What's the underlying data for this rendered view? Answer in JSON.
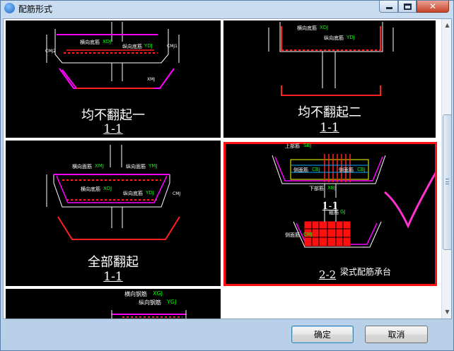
{
  "window": {
    "title": "配筋形式",
    "close_glyph": "✕"
  },
  "options": [
    {
      "caption": "均不翻起一",
      "section": "1-1",
      "labels": [
        "横向底筋",
        "XDJ",
        "纵向底筋",
        "YDJ",
        "CMJ1",
        "CMJ2",
        "XMJ"
      ]
    },
    {
      "caption": "均不翻起二",
      "section": "1-1",
      "labels": [
        "横向底筋",
        "XDJ",
        "纵向底筋",
        "YDJ"
      ]
    },
    {
      "caption": "全部翻起",
      "section": "1-1",
      "labels": [
        "横向面筋",
        "XMJ",
        "纵向面筋",
        "YMJ",
        "横向底筋",
        "XDJ",
        "纵向底筋",
        "YDJ",
        "CMJ"
      ]
    },
    {
      "caption": "梁式配筋承台",
      "section": "2-2",
      "labels": [
        "上部筋",
        "SBJ",
        "侧面筋",
        "CBJ",
        "侧面筋",
        "CBJ",
        "下部筋",
        "XBJ",
        "箍筋",
        "GJ",
        "侧面筋",
        "CMJ"
      ],
      "section_top": "1-1",
      "selected": true
    },
    {
      "caption": "",
      "section": "",
      "labels": [
        "横向钢筋",
        "XGJ",
        "纵向钢筋",
        "YGJ"
      ]
    }
  ],
  "scrollbar": {
    "up": "▲",
    "down": "▼"
  },
  "buttons": {
    "ok": "确定",
    "cancel": "取消"
  }
}
